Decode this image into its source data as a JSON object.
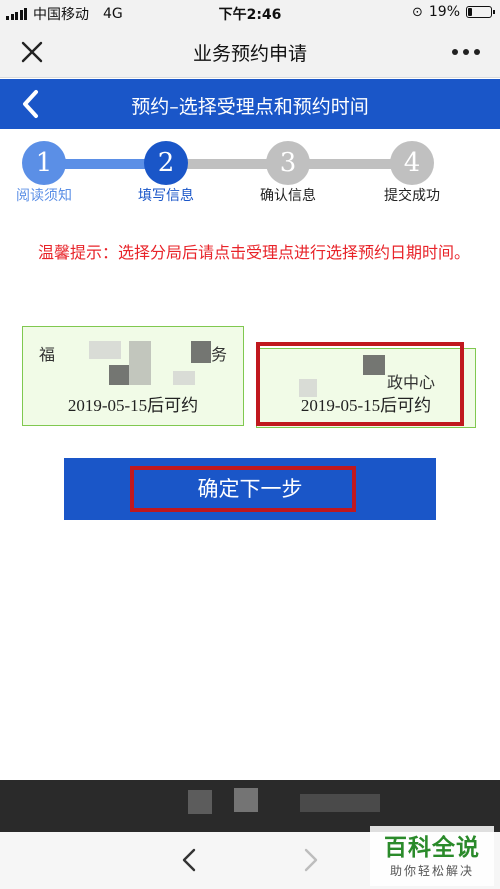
{
  "status_bar": {
    "carrier": "中国移动",
    "network": "4G",
    "time": "下午2:46",
    "battery_percent": "19%",
    "battery_level": 0.19
  },
  "titlebar": {
    "title": "业务预约申请",
    "close_icon": "close-icon",
    "more_icon": "more-icon"
  },
  "header": {
    "title": "预约–选择受理点和预约时间",
    "back_icon": "chevron-left-icon"
  },
  "steps": [
    {
      "number": "1",
      "label": "阅读须知",
      "state": "done"
    },
    {
      "number": "2",
      "label": "填写信息",
      "state": "current"
    },
    {
      "number": "3",
      "label": "确认信息",
      "state": "pending"
    },
    {
      "number": "4",
      "label": "提交成功",
      "state": "pending"
    }
  ],
  "tip": "温馨提示：选择分局后请点击受理点进行选择预约日期时间。",
  "locations": [
    {
      "name_start": "福",
      "name_end": "务",
      "date": "2019-05-15后可约"
    },
    {
      "name_end": "政中心",
      "date": "2019-05-15后可约"
    }
  ],
  "confirm_button": "确定下一步",
  "watermark": {
    "title": "百科全说",
    "subtitle": "助你轻松解决"
  },
  "colors": {
    "primary": "#1a56c8",
    "step_done": "#5b8fe6",
    "step_pending": "#c0c0c0",
    "warning": "#e8242a",
    "card_border": "#80c850",
    "card_bg": "#f1fbe7",
    "highlight": "#c0181e"
  }
}
